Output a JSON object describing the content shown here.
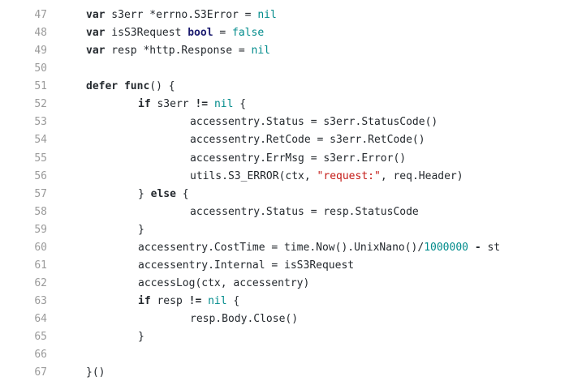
{
  "colors": {
    "background": "#ffffff",
    "line_number": "#9a9a9a",
    "text": "#24292e",
    "keyword": "#24292e",
    "type": "#1a1a6e",
    "literal": "#008b8b",
    "string": "#c41a16",
    "number": "#008b8b"
  },
  "cut_line": "",
  "lines": [
    {
      "n": "47",
      "indent": 1,
      "parts": [
        [
          "kw",
          "var"
        ],
        [
          "p",
          " s3err *errno.S3Error = "
        ],
        [
          "lit",
          "nil"
        ]
      ]
    },
    {
      "n": "48",
      "indent": 1,
      "parts": [
        [
          "kw",
          "var"
        ],
        [
          "p",
          " isS3Request "
        ],
        [
          "ty",
          "bool"
        ],
        [
          "p",
          " = "
        ],
        [
          "lit",
          "false"
        ]
      ]
    },
    {
      "n": "49",
      "indent": 1,
      "parts": [
        [
          "kw",
          "var"
        ],
        [
          "p",
          " resp *http.Response = "
        ],
        [
          "lit",
          "nil"
        ]
      ]
    },
    {
      "n": "50",
      "indent": 1,
      "parts": []
    },
    {
      "n": "51",
      "indent": 1,
      "parts": [
        [
          "kw",
          "defer"
        ],
        [
          "p",
          " "
        ],
        [
          "kw",
          "func"
        ],
        [
          "p",
          "() {"
        ]
      ]
    },
    {
      "n": "52",
      "indent": 2,
      "parts": [
        [
          "kw",
          "if"
        ],
        [
          "p",
          " s3err "
        ],
        [
          "kw",
          "!="
        ],
        [
          "p",
          " "
        ],
        [
          "lit",
          "nil"
        ],
        [
          "p",
          " {"
        ]
      ]
    },
    {
      "n": "53",
      "indent": 3,
      "parts": [
        [
          "p",
          "accessentry.Status = s3err.StatusCode()"
        ]
      ]
    },
    {
      "n": "54",
      "indent": 3,
      "parts": [
        [
          "p",
          "accessentry.RetCode = s3err.RetCode()"
        ]
      ]
    },
    {
      "n": "55",
      "indent": 3,
      "parts": [
        [
          "p",
          "accessentry.ErrMsg = s3err.Error()"
        ]
      ]
    },
    {
      "n": "56",
      "indent": 3,
      "parts": [
        [
          "p",
          "utils.S3_ERROR(ctx, "
        ],
        [
          "str",
          "\"request:\""
        ],
        [
          "p",
          ", req.Header)"
        ]
      ]
    },
    {
      "n": "57",
      "indent": 2,
      "parts": [
        [
          "p",
          "} "
        ],
        [
          "kw",
          "else"
        ],
        [
          "p",
          " {"
        ]
      ]
    },
    {
      "n": "58",
      "indent": 3,
      "parts": [
        [
          "p",
          "accessentry.Status = resp.StatusCode"
        ]
      ]
    },
    {
      "n": "59",
      "indent": 2,
      "parts": [
        [
          "p",
          "}"
        ]
      ]
    },
    {
      "n": "60",
      "indent": 2,
      "parts": [
        [
          "p",
          "accessentry.CostTime = time.Now().UnixNano()/"
        ],
        [
          "num",
          "1000000"
        ],
        [
          "p",
          " "
        ],
        [
          "kw",
          "-"
        ],
        [
          "p",
          " st"
        ]
      ]
    },
    {
      "n": "61",
      "indent": 2,
      "parts": [
        [
          "p",
          "accessentry.Internal = isS3Request"
        ]
      ]
    },
    {
      "n": "62",
      "indent": 2,
      "parts": [
        [
          "p",
          "accessLog(ctx, accessentry)"
        ]
      ]
    },
    {
      "n": "63",
      "indent": 2,
      "parts": [
        [
          "kw",
          "if"
        ],
        [
          "p",
          " resp "
        ],
        [
          "kw",
          "!="
        ],
        [
          "p",
          " "
        ],
        [
          "lit",
          "nil"
        ],
        [
          "p",
          " {"
        ]
      ]
    },
    {
      "n": "64",
      "indent": 3,
      "parts": [
        [
          "p",
          "resp.Body.Close()"
        ]
      ]
    },
    {
      "n": "65",
      "indent": 2,
      "parts": [
        [
          "p",
          "}"
        ]
      ]
    },
    {
      "n": "66",
      "indent": 1,
      "parts": []
    },
    {
      "n": "67",
      "indent": 1,
      "parts": [
        [
          "p",
          "}()"
        ]
      ]
    }
  ]
}
